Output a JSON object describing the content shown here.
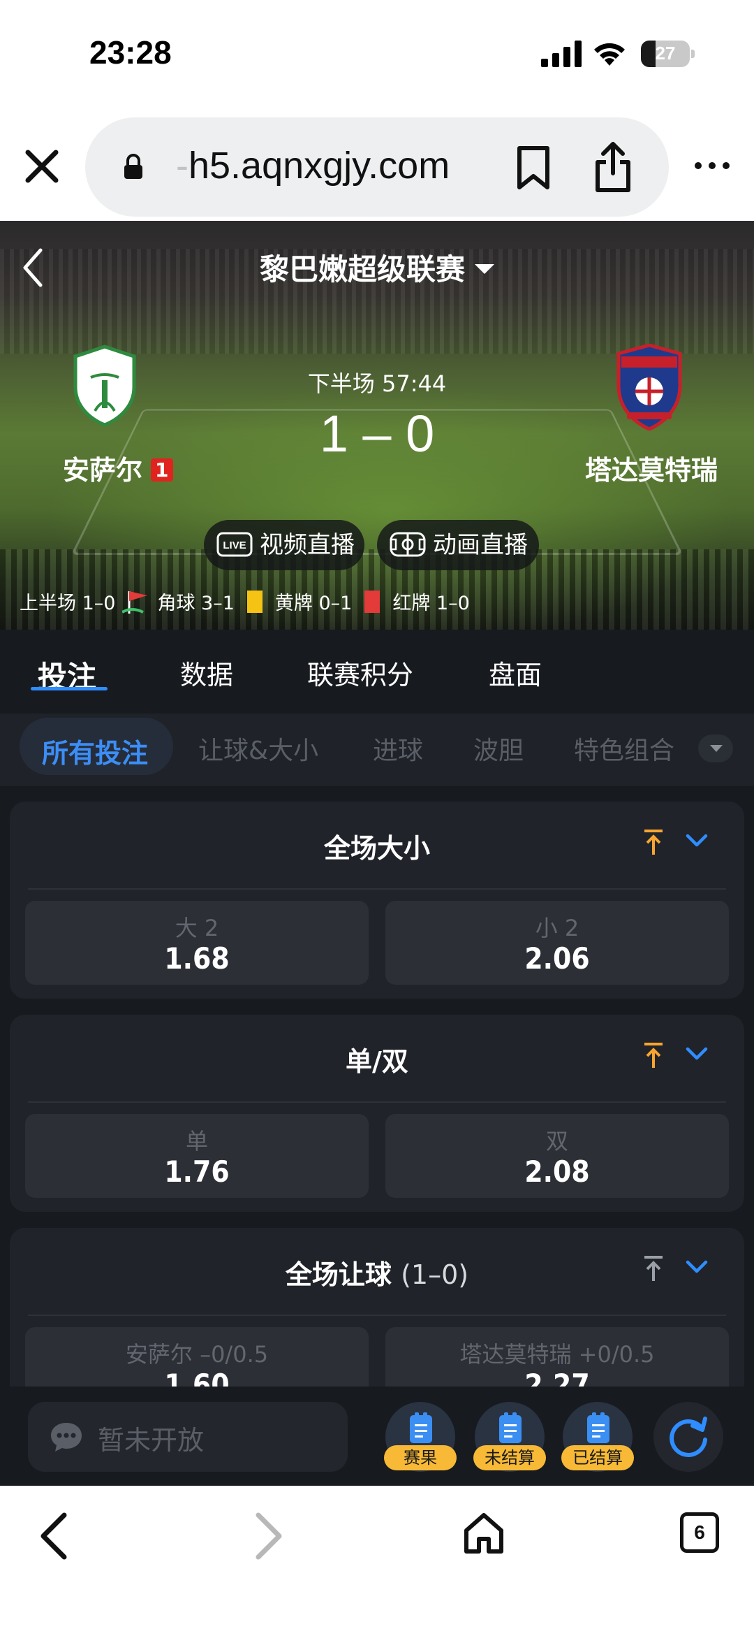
{
  "status_bar": {
    "time": "23:28",
    "battery": "27"
  },
  "browser": {
    "url_faded": "-",
    "url_main": "h5.aqnxgjy.com",
    "tab_count": "6"
  },
  "match": {
    "league": "黎巴嫩超级联赛",
    "period": "下半场 57:44",
    "score": "1 – 0",
    "home_team": "安萨尔",
    "home_red_cards": "1",
    "away_team": "塔达莫特瑞",
    "video_live": "视频直播",
    "anim_live": "动画直播",
    "live_badge": "LIVE",
    "stats": {
      "first_half": "上半场 1–0",
      "corners": "角球 3–1",
      "yellow": "黄牌 0–1",
      "red": "红牌 1–0"
    }
  },
  "tabs": [
    "投注",
    "数据",
    "联赛积分",
    "盘面"
  ],
  "subtabs": [
    "所有投注",
    "让球&大小",
    "进球",
    "波胆",
    "特色组合"
  ],
  "markets": [
    {
      "title": "全场大小",
      "title_extra": "",
      "pinned": true,
      "left": {
        "label": "大 2",
        "odds": "1.68"
      },
      "right": {
        "label": "小 2",
        "odds": "2.06"
      }
    },
    {
      "title": "单/双",
      "title_extra": "",
      "pinned": true,
      "left": {
        "label": "单",
        "odds": "1.76"
      },
      "right": {
        "label": "双",
        "odds": "2.08"
      }
    },
    {
      "title": "全场让球",
      "title_extra": "(1–0)",
      "pinned": false,
      "left": {
        "label": "安萨尔 –0/0.5",
        "odds": "1.60"
      },
      "right": {
        "label": "塔达莫特瑞 +0/0.5",
        "odds": "2.27"
      }
    }
  ],
  "action_bar": {
    "chat_placeholder": "暂未开放",
    "results_label": "赛果",
    "unsettled_label": "未结算",
    "settled_label": "已结算"
  },
  "colors": {
    "accent": "#2f8dff",
    "pin_active": "#f7a531",
    "badge": "#f7b936",
    "red_card": "#e33a3a",
    "yellow_card": "#f5c313"
  },
  "icons": [
    "close-icon",
    "lock-icon",
    "bookmark-icon",
    "share-icon",
    "more-icon",
    "back-chevron-icon",
    "caret-down-icon",
    "live-tv-icon",
    "pitch-icon",
    "corner-flag-icon",
    "pin-top-icon",
    "chevron-down-icon",
    "chat-bubble-icon",
    "document-icon",
    "refresh-icon",
    "home-icon"
  ]
}
